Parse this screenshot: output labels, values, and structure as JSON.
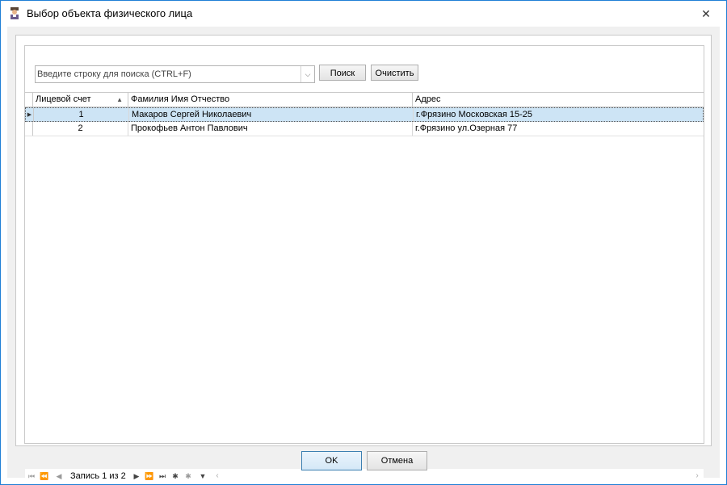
{
  "window": {
    "title": "Выбор объекта физического лица",
    "close_glyph": "✕"
  },
  "search": {
    "placeholder": "Введите строку для поиска (CTRL+F)",
    "value": "",
    "find_label": "Поиск",
    "clear_label": "Очистить"
  },
  "grid": {
    "columns": [
      "Лицевой счет",
      "Фамилия Имя Отчество",
      "Адрес"
    ],
    "sorted_column": "Лицевой счет",
    "rows": [
      {
        "account": "1",
        "name": "Макаров Сергей Николаевич",
        "address": "г.Фрязино Московская 15-25"
      },
      {
        "account": "2",
        "name": "Прокофьев Антон Павлович",
        "address": "г.Фрязино ул.Озерная 77"
      }
    ],
    "selected_row": 0
  },
  "navigator": {
    "record_text": "Запись 1 из 2"
  },
  "buttons": {
    "ok": "OK",
    "cancel": "Отмена"
  },
  "colors": {
    "window_border": "#1f7fd6",
    "selection": "#cde4f5"
  }
}
